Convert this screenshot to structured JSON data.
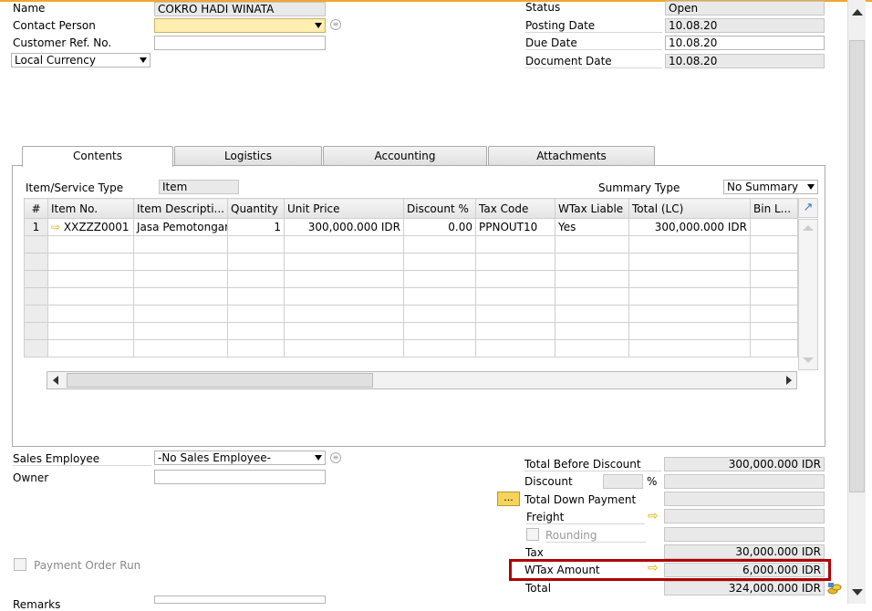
{
  "header": {
    "name_label": "Name",
    "name_value": "COKRO HADI WINATA",
    "contact_label": "Contact Person",
    "contact_value": "",
    "custref_label": "Customer Ref. No.",
    "custref_value": "",
    "currency_value": "Local Currency",
    "status_label": "Status",
    "status_value": "Open",
    "posting_label": "Posting Date",
    "posting_value": "10.08.20",
    "due_label": "Due Date",
    "due_value": "10.08.20",
    "docdate_label": "Document Date",
    "docdate_value": "10.08.20"
  },
  "tabs": [
    "Contents",
    "Logistics",
    "Accounting",
    "Attachments"
  ],
  "contents": {
    "type_label": "Item/Service Type",
    "type_value": "Item",
    "summary_label": "Summary Type",
    "summary_value": "No Summary",
    "columns": [
      "#",
      "Item No.",
      "Item Descripti...",
      "Quantity",
      "Unit Price",
      "Discount %",
      "Tax Code",
      "WTax Liable",
      "Total (LC)",
      "Bin L..."
    ],
    "rows": [
      {
        "num": "1",
        "item_no": "XXZZZ0001",
        "desc": "Jasa Pemotongan",
        "qty": "1",
        "price": "300,000.000 IDR",
        "disc": "0.00",
        "tax": "PPNOUT10",
        "wtax": "Yes",
        "total": "300,000.000 IDR",
        "bin": ""
      }
    ]
  },
  "footer": {
    "sales_label": "Sales Employee",
    "sales_value": "-No Sales Employee-",
    "owner_label": "Owner",
    "owner_value": "",
    "payment_run_label": "Payment Order Run",
    "remarks_label": "Remarks",
    "tbd_label": "Total Before Discount",
    "tbd_value": "300,000.000 IDR",
    "discount_label": "Discount",
    "percent": "%",
    "tdp_label": "Total Down Payment",
    "dots": "...",
    "freight_label": "Freight",
    "rounding_label": "Rounding",
    "tax_label": "Tax",
    "tax_value": "30,000.000 IDR",
    "wtax_label": "WTax Amount",
    "wtax_value": "6,000.000 IDR",
    "total_label": "Total",
    "total_value": "324,000.000 IDR"
  }
}
